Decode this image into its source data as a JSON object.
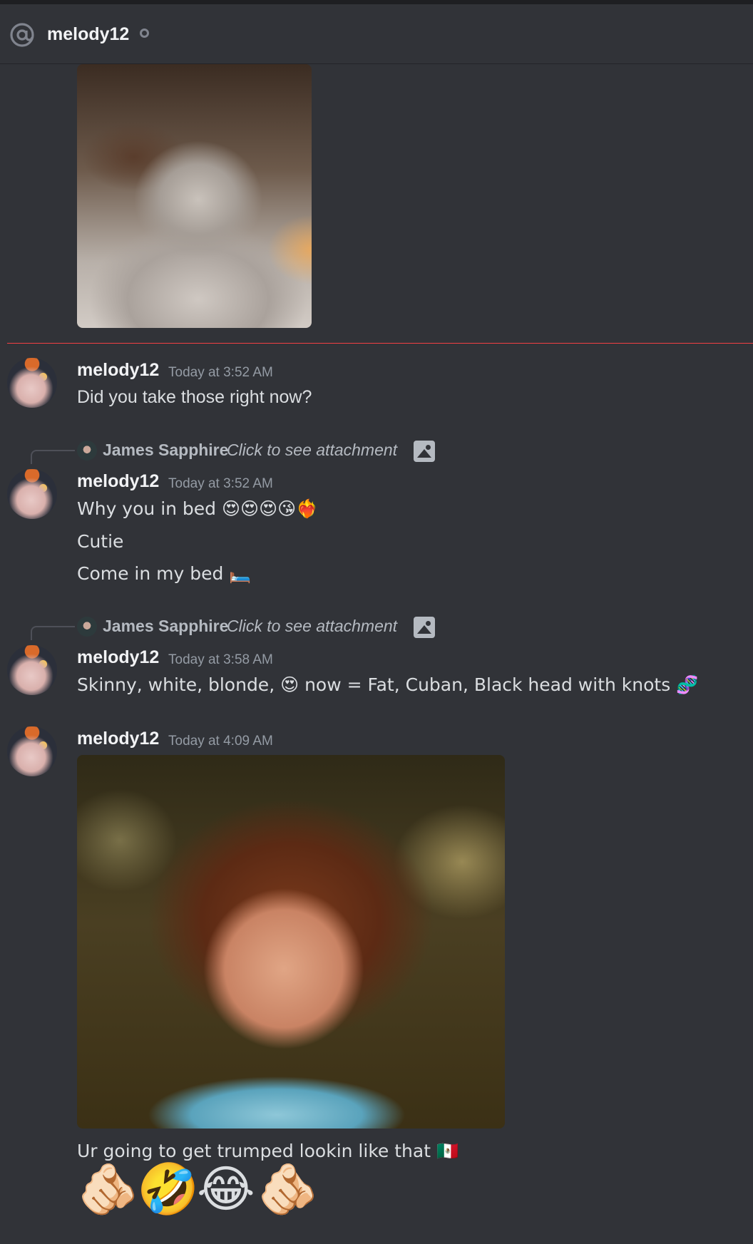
{
  "header": {
    "at_icon": "at-sign-icon",
    "channel_name": "melody12",
    "status_icon": "offline-status-icon"
  },
  "messages": [
    {
      "author": "melody12",
      "timestamp": "Today at 3:52 AM",
      "text": "Did you take those right now?"
    },
    {
      "reply": {
        "name": "James Sapphire",
        "text": "Click to see attachment",
        "icon": "image-icon"
      },
      "author": "melody12",
      "timestamp": "Today at 3:52 AM",
      "lines": [
        "Why you in bed 😍😍😍😘❤️‍🔥",
        "Cutie",
        "Come in my bed 🛏️"
      ]
    },
    {
      "reply": {
        "name": "James Sapphire",
        "text": "Click to see attachment",
        "icon": "image-icon"
      },
      "author": "melody12",
      "timestamp": "Today at 3:58 AM",
      "text": "Skinny, white, blonde, 😍 now = Fat, Cuban, Black head with knots 🧬"
    },
    {
      "author": "melody12",
      "timestamp": "Today at 4:09 AM",
      "text": "Ur going to get trumped lookin like that 🇲🇽",
      "emoji_row": [
        "🫵🏻",
        "🤣",
        "😂",
        "🫵🏻"
      ]
    }
  ]
}
